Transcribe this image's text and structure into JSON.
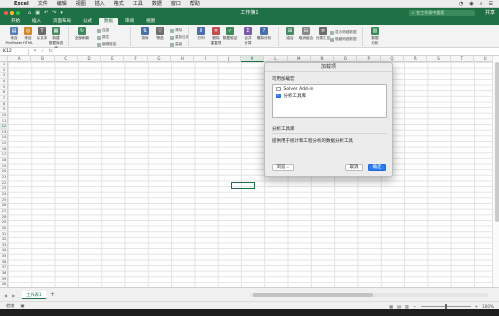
{
  "menubar": {
    "apple": "",
    "items": [
      "Excel",
      "文件",
      "编辑",
      "视图",
      "插入",
      "格式",
      "工具",
      "数据",
      "窗口",
      "帮助"
    ],
    "right_icons": [
      "◔",
      "◉",
      "⌕",
      "☰"
    ]
  },
  "window": {
    "title": "工作簿1",
    "search_placeholder": "在工作表中搜索",
    "quick_access": [
      "⌂",
      "▣",
      "↶",
      "↷",
      "▾"
    ],
    "user": "共享"
  },
  "tabs": [
    "开始",
    "插入",
    "页面布局",
    "公式",
    "数据",
    "审阅",
    "视图"
  ],
  "active_tab": "数据",
  "ribbon": {
    "buttons": [
      {
        "label": "来自\nFileMaker",
        "icon": "▤"
      },
      {
        "label": "来自\nHTML",
        "icon": "◎"
      },
      {
        "label": "从文本",
        "icon": "T"
      },
      {
        "label": "新建\n数据库查询",
        "icon": "▦"
      },
      {
        "label": "全部刷新",
        "icon": "↻"
      },
      {
        "label": "排序",
        "icon": "⇅"
      },
      {
        "label": "筛选",
        "icon": "▽"
      },
      {
        "label": "分列",
        "icon": "⫴"
      },
      {
        "label": "删除\n重复项",
        "icon": "✕"
      },
      {
        "label": "数据验证",
        "icon": "✓"
      },
      {
        "label": "合并\n计算",
        "icon": "Σ"
      },
      {
        "label": "模拟分析",
        "icon": "?"
      },
      {
        "label": "组合",
        "icon": "⊞"
      },
      {
        "label": "取消组合",
        "icon": "⊟"
      },
      {
        "label": "分类汇总",
        "icon": "≡"
      },
      {
        "label": "数据\n分析",
        "icon": "▥"
      }
    ],
    "small_items": [
      "连接",
      "属性",
      "编辑链接",
      "清除",
      "重新应用",
      "高级",
      "显示明细数据",
      "隐藏明细数据"
    ]
  },
  "formula_bar": {
    "name_box": "K12",
    "icons": [
      "✕",
      "✓",
      "fx"
    ],
    "value": ""
  },
  "grid": {
    "columns": [
      "A",
      "B",
      "C",
      "D",
      "E",
      "F",
      "G",
      "H",
      "I",
      "J",
      "K",
      "L",
      "M",
      "N",
      "O",
      "P",
      "Q",
      "R",
      "S",
      "T",
      "U"
    ],
    "row_count": 40,
    "active_cell": "K12"
  },
  "sheet_tabs": {
    "nav": [
      "◀",
      "▶"
    ],
    "tabs": [
      "工作表1"
    ],
    "add": "+"
  },
  "status_bar": {
    "text": [
      "就绪",
      "▣"
    ],
    "zoom": "100%",
    "view_icons": [
      "▦",
      "▤",
      "▥"
    ]
  },
  "addins_dialog": {
    "title": "加载项",
    "available_label": "可用加载宏",
    "items": [
      {
        "label": "Solver Add-in",
        "checked": false
      },
      {
        "label": "分析工具库",
        "checked": true
      }
    ],
    "description_title": "分析工具库",
    "description": "提供用于统计和工程分析的数据分析工具",
    "browse_label": "浏览...",
    "cancel_label": "取消",
    "ok_label": "确定"
  },
  "colors": {
    "excel_green": "#1f7145",
    "accent_blue": "#2a7bf6",
    "traffic_red": "#fd5c55",
    "traffic_yellow": "#fdbc2e",
    "traffic_green": "#2ac941"
  }
}
